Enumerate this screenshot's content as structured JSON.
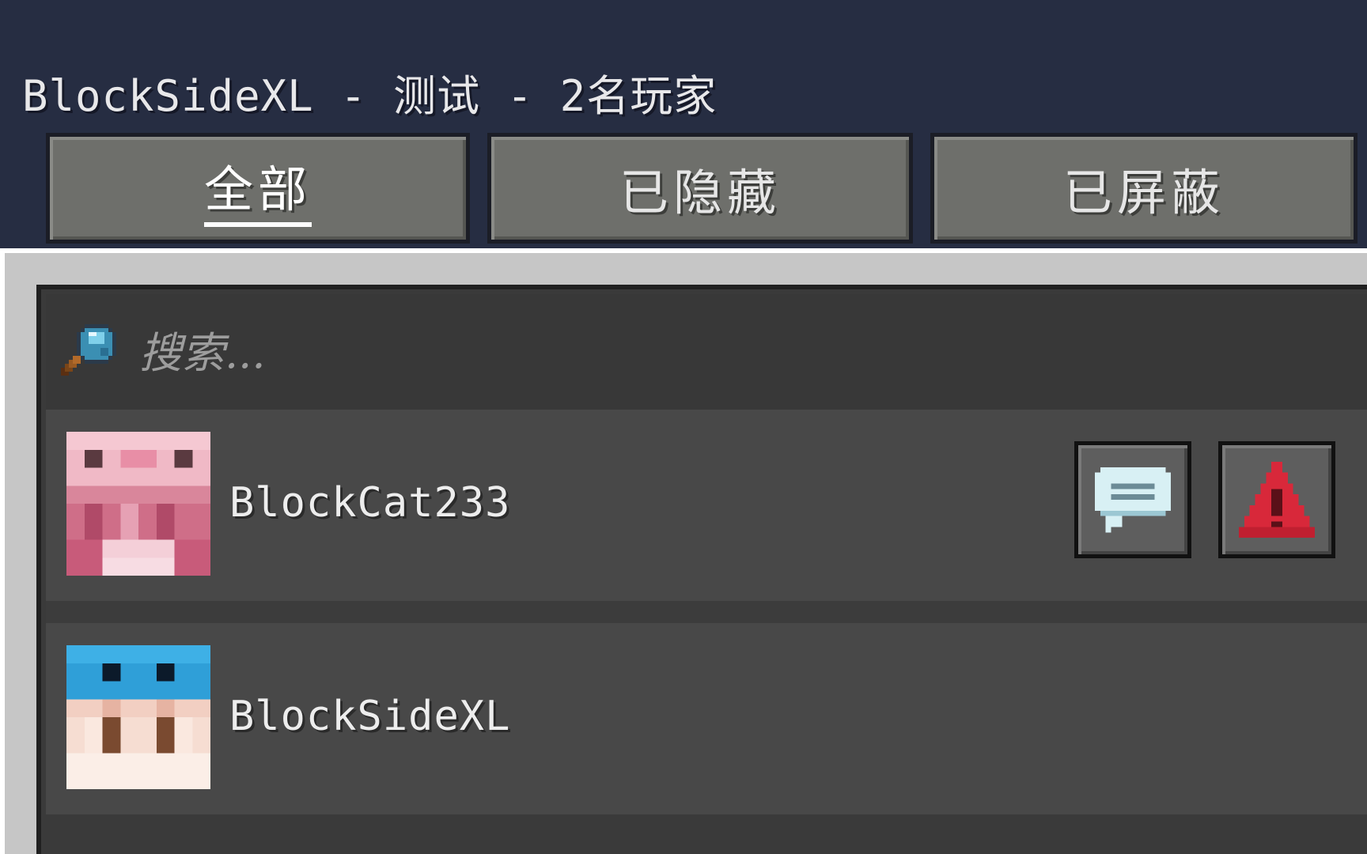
{
  "header": {
    "title": "BlockSideXL - 测试 - 2名玩家"
  },
  "tabs": [
    {
      "label": "全部",
      "active": true
    },
    {
      "label": "已隐藏",
      "active": false
    },
    {
      "label": "已屏蔽",
      "active": false
    }
  ],
  "search": {
    "placeholder": "搜索...",
    "icon": "magnifier-icon"
  },
  "players": [
    {
      "name": "BlockCat233",
      "avatar": "pink-pixel-skin",
      "actions": [
        {
          "icon": "chat-bubble-icon",
          "color": "#bfe3ea"
        },
        {
          "icon": "warning-triangle-icon",
          "color": "#d8283a"
        }
      ]
    },
    {
      "name": "BlockSideXL",
      "avatar": "blue-cap-pixel-skin",
      "actions": []
    }
  ],
  "colors": {
    "background": "#262d42",
    "tab": "#6e6f6b",
    "panel": "#3a3a3a",
    "row": "#484848",
    "report": "#d8283a"
  }
}
